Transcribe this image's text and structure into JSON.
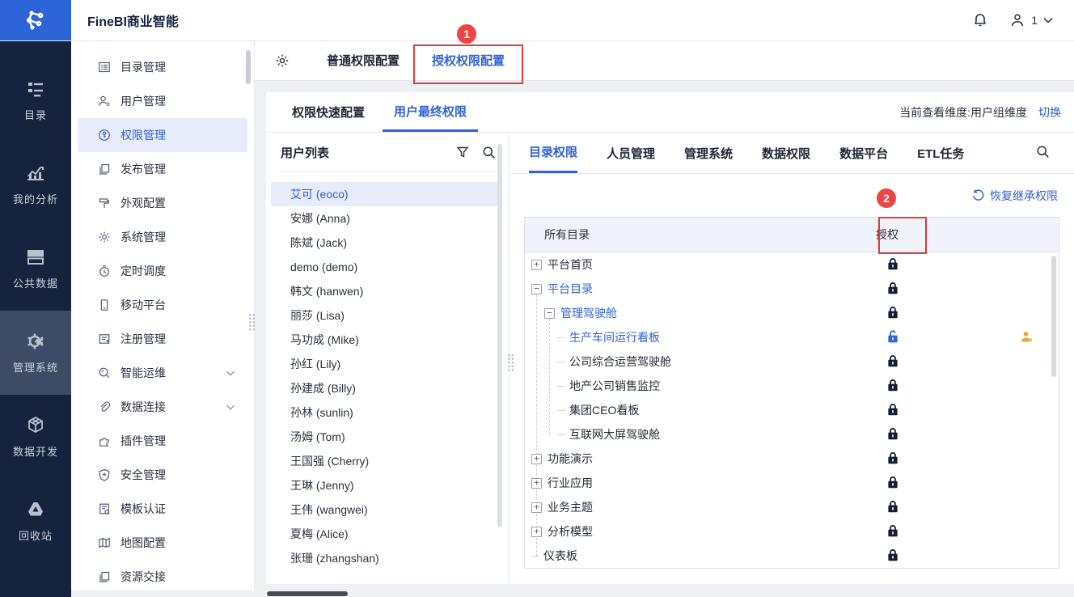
{
  "topbar": {
    "title": "FineBI商业智能",
    "user_count": "1",
    "icons": [
      "notification-bell",
      "user-avatar",
      "chevron-down"
    ]
  },
  "left_rail": {
    "items": [
      {
        "label": "目录",
        "icon": "directory"
      },
      {
        "label": "我的分析",
        "icon": "analysis"
      },
      {
        "label": "公共数据",
        "icon": "publicdata"
      },
      {
        "label": "管理系统",
        "icon": "admin",
        "active": true
      },
      {
        "label": "数据开发",
        "icon": "datadev"
      },
      {
        "label": "回收站",
        "icon": "recycle"
      }
    ]
  },
  "sidebar": {
    "items": [
      {
        "label": "目录管理",
        "icon": "catalog"
      },
      {
        "label": "用户管理",
        "icon": "user"
      },
      {
        "label": "权限管理",
        "icon": "permission",
        "active": true
      },
      {
        "label": "发布管理",
        "icon": "publish"
      },
      {
        "label": "外观配置",
        "icon": "appearance"
      },
      {
        "label": "系统管理",
        "icon": "system"
      },
      {
        "label": "定时调度",
        "icon": "schedule"
      },
      {
        "label": "移动平台",
        "icon": "mobile"
      },
      {
        "label": "注册管理",
        "icon": "register"
      },
      {
        "label": "智能运维",
        "icon": "ops",
        "chevron": true
      },
      {
        "label": "数据连接",
        "icon": "connection",
        "chevron": true
      },
      {
        "label": "插件管理",
        "icon": "plugin"
      },
      {
        "label": "安全管理",
        "icon": "security"
      },
      {
        "label": "模板认证",
        "icon": "template"
      },
      {
        "label": "地图配置",
        "icon": "map"
      },
      {
        "label": "资源交接",
        "icon": "handover"
      }
    ]
  },
  "perm_tabs": {
    "tab1": "普通权限配置",
    "tab2": "授权权限配置"
  },
  "sub_tabs": {
    "tab1": "权限快速配置",
    "tab2": "用户最终权限"
  },
  "view_dimension": {
    "label": "当前查看维度:用户组维度",
    "switch_label": "切换"
  },
  "user_list": {
    "title": "用户列表",
    "selected_index": 0,
    "users": [
      "艾可 (eoco)",
      "安娜 (Anna)",
      "陈斌 (Jack)",
      "demo (demo)",
      "韩文 (hanwen)",
      "丽莎 (Lisa)",
      "马功成 (Mike)",
      "孙红 (Lily)",
      "孙建成 (Billy)",
      "孙林 (sunlin)",
      "汤姆 (Tom)",
      "王国强 (Cherry)",
      "王琳 (Jenny)",
      "王伟 (wangwei)",
      "夏梅 (Alice)",
      "张珊 (zhangshan)"
    ]
  },
  "right_tabs": {
    "items": [
      "目录权限",
      "人员管理",
      "管理系统",
      "数据权限",
      "数据平台",
      "ETL任务"
    ],
    "active_index": 0
  },
  "restore_link": "恢复继承权限",
  "table": {
    "col_directory": "所有目录",
    "col_auth": "授权",
    "rows": [
      {
        "label": "平台首页",
        "level": 0,
        "node": "plus",
        "color": "dark",
        "lock": "locked"
      },
      {
        "label": "平台目录",
        "level": 0,
        "node": "minus",
        "color": "blue",
        "lock": "locked"
      },
      {
        "label": "管理驾驶舱",
        "level": 1,
        "node": "minus",
        "color": "blue",
        "lock": "locked"
      },
      {
        "label": "生产车间运行看板",
        "level": 2,
        "node": "leaf",
        "color": "blue",
        "lock": "unlocked",
        "person": true
      },
      {
        "label": "公司综合运营驾驶舱",
        "level": 2,
        "node": "leaf",
        "color": "dark",
        "lock": "locked"
      },
      {
        "label": "地产公司销售监控",
        "level": 2,
        "node": "leaf",
        "color": "dark",
        "lock": "locked"
      },
      {
        "label": "集团CEO看板",
        "level": 2,
        "node": "leaf",
        "color": "dark",
        "lock": "locked"
      },
      {
        "label": "互联网大屏驾驶舱",
        "level": 2,
        "node": "leaf",
        "color": "dark",
        "lock": "locked"
      },
      {
        "label": "功能演示",
        "level": 0,
        "node": "plus",
        "color": "dark",
        "lock": "locked"
      },
      {
        "label": "行业应用",
        "level": 0,
        "node": "plus",
        "color": "dark",
        "lock": "locked"
      },
      {
        "label": "业务主题",
        "level": 0,
        "node": "plus",
        "color": "dark",
        "lock": "locked"
      },
      {
        "label": "分析模型",
        "level": 0,
        "node": "plus",
        "color": "dark",
        "lock": "locked"
      },
      {
        "label": "仪表板",
        "level": 0,
        "node": "leaf",
        "color": "dark",
        "lock": "locked"
      }
    ]
  },
  "annotations": {
    "step1": "1",
    "step2": "2"
  },
  "colors": {
    "primary_blue": "#3062d4",
    "logo_blue": "#2e64d9",
    "rail_navy": "#16233f",
    "annotation_red": "#e23b3b",
    "lock_navy": "#121d33",
    "person_orange": "#e8a33d",
    "selected_bg": "#e8ecfa",
    "table_head_bg": "#f0f3f9"
  }
}
